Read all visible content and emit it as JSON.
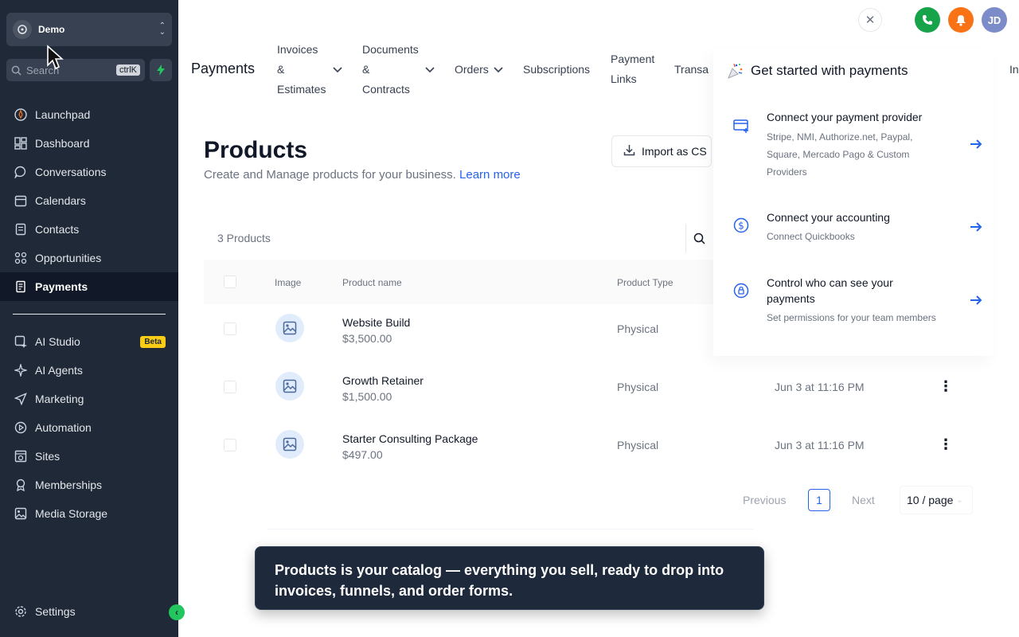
{
  "sidebar": {
    "account_name": "Demo",
    "search_placeholder": "Search",
    "search_shortcut": "ctrlK",
    "items": [
      {
        "label": "Launchpad",
        "icon": "rocket-icon"
      },
      {
        "label": "Dashboard",
        "icon": "dashboard-icon"
      },
      {
        "label": "Conversations",
        "icon": "chat-icon"
      },
      {
        "label": "Calendars",
        "icon": "calendar-icon"
      },
      {
        "label": "Contacts",
        "icon": "contacts-icon"
      },
      {
        "label": "Opportunities",
        "icon": "opportunities-icon"
      },
      {
        "label": "Payments",
        "icon": "payments-icon",
        "active": true
      },
      {
        "label": "AI Studio",
        "icon": "ai-studio-icon",
        "badge": "Beta"
      },
      {
        "label": "AI Agents",
        "icon": "sparkle-icon"
      },
      {
        "label": "Marketing",
        "icon": "send-icon"
      },
      {
        "label": "Automation",
        "icon": "automation-icon"
      },
      {
        "label": "Sites",
        "icon": "sites-icon"
      },
      {
        "label": "Memberships",
        "icon": "memberships-icon"
      },
      {
        "label": "Media Storage",
        "icon": "media-icon"
      }
    ],
    "settings_label": "Settings"
  },
  "topnav": {
    "title": "Payments",
    "invoices": [
      "Invoices",
      "&",
      "Estimates"
    ],
    "documents": [
      "Documents",
      "&",
      "Contracts"
    ],
    "orders": "Orders",
    "subscriptions": "Subscriptions",
    "payment_links": [
      "Payment",
      "Links"
    ],
    "transactions_partial": "Transa"
  },
  "header": {
    "avatar_initials": "JD",
    "colors": {
      "phone": "#16a34a",
      "bell": "#f97316",
      "avatar": "#7c8cc9"
    }
  },
  "main": {
    "title": "Products",
    "subtitle": "Create and Manage products for your business.",
    "learn_more": "Learn more",
    "import_label": "Import as CS",
    "count_label": "3 Products",
    "columns": {
      "image": "Image",
      "name": "Product name",
      "type": "Product Type"
    },
    "rows": [
      {
        "name": "Website Build",
        "price": "$3,500.00",
        "type": "Physical",
        "date": ""
      },
      {
        "name": "Growth Retainer",
        "price": "$1,500.00",
        "type": "Physical",
        "date": "Jun 3 at 11:16 PM"
      },
      {
        "name": "Starter Consulting Package",
        "price": "$497.00",
        "type": "Physical",
        "date": "Jun 3 at 11:16 PM"
      }
    ],
    "pagination": {
      "previous": "Previous",
      "current": "1",
      "next": "Next",
      "page_size": "10 / page"
    }
  },
  "get_started": {
    "title": "Get started with payments",
    "edge_text": "In",
    "items": [
      {
        "title": "Connect your payment provider",
        "desc": "Stripe, NMI, Authorize.net, Paypal, Square, Mercado Pago & Custom Providers"
      },
      {
        "title": "Connect your accounting",
        "desc": "Connect Quickbooks"
      },
      {
        "title": "Control who can see your payments",
        "desc": "Set permissions for your team members"
      }
    ]
  },
  "toast": {
    "message": "Products is your catalog — everything you sell, ready to drop into invoices, funnels, and order forms."
  }
}
